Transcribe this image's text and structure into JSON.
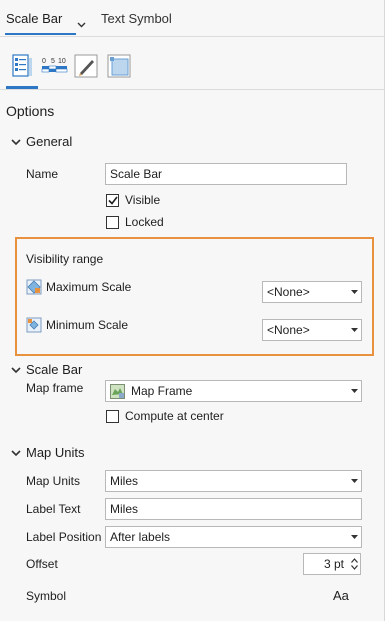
{
  "tabs": {
    "scale_bar": "Scale Bar",
    "text_symbol": "Text Symbol"
  },
  "icon_tabs": {
    "options": "options-list-icon",
    "scale": "scale-bar-icon",
    "edit": "pencil-icon",
    "frame": "display-frame-icon",
    "scale_digits": [
      "0",
      "5",
      "10"
    ]
  },
  "heading": "Options",
  "general": {
    "title": "General",
    "name_label": "Name",
    "name_value": "Scale Bar",
    "visible_label": "Visible",
    "visible_checked": true,
    "locked_label": "Locked",
    "locked_checked": false
  },
  "visibility": {
    "title": "Visibility range",
    "max_label": "Maximum Scale",
    "max_value": "<None>",
    "min_label": "Minimum Scale",
    "min_value": "<None>"
  },
  "scale_bar": {
    "title": "Scale Bar",
    "map_frame_label": "Map frame",
    "map_frame_value": "Map Frame",
    "compute_label": "Compute at center",
    "compute_checked": false
  },
  "map_units": {
    "title": "Map Units",
    "units_label": "Map Units",
    "units_value": "Miles",
    "label_text_label": "Label Text",
    "label_text_value": "Miles",
    "label_pos_label": "Label Position",
    "label_pos_value": "After labels",
    "offset_label": "Offset",
    "offset_value": "3 pt",
    "symbol_label": "Symbol",
    "symbol_value": "Aa"
  },
  "colors": {
    "accent": "#2d77c4",
    "highlight_frame": "#e8913f"
  }
}
